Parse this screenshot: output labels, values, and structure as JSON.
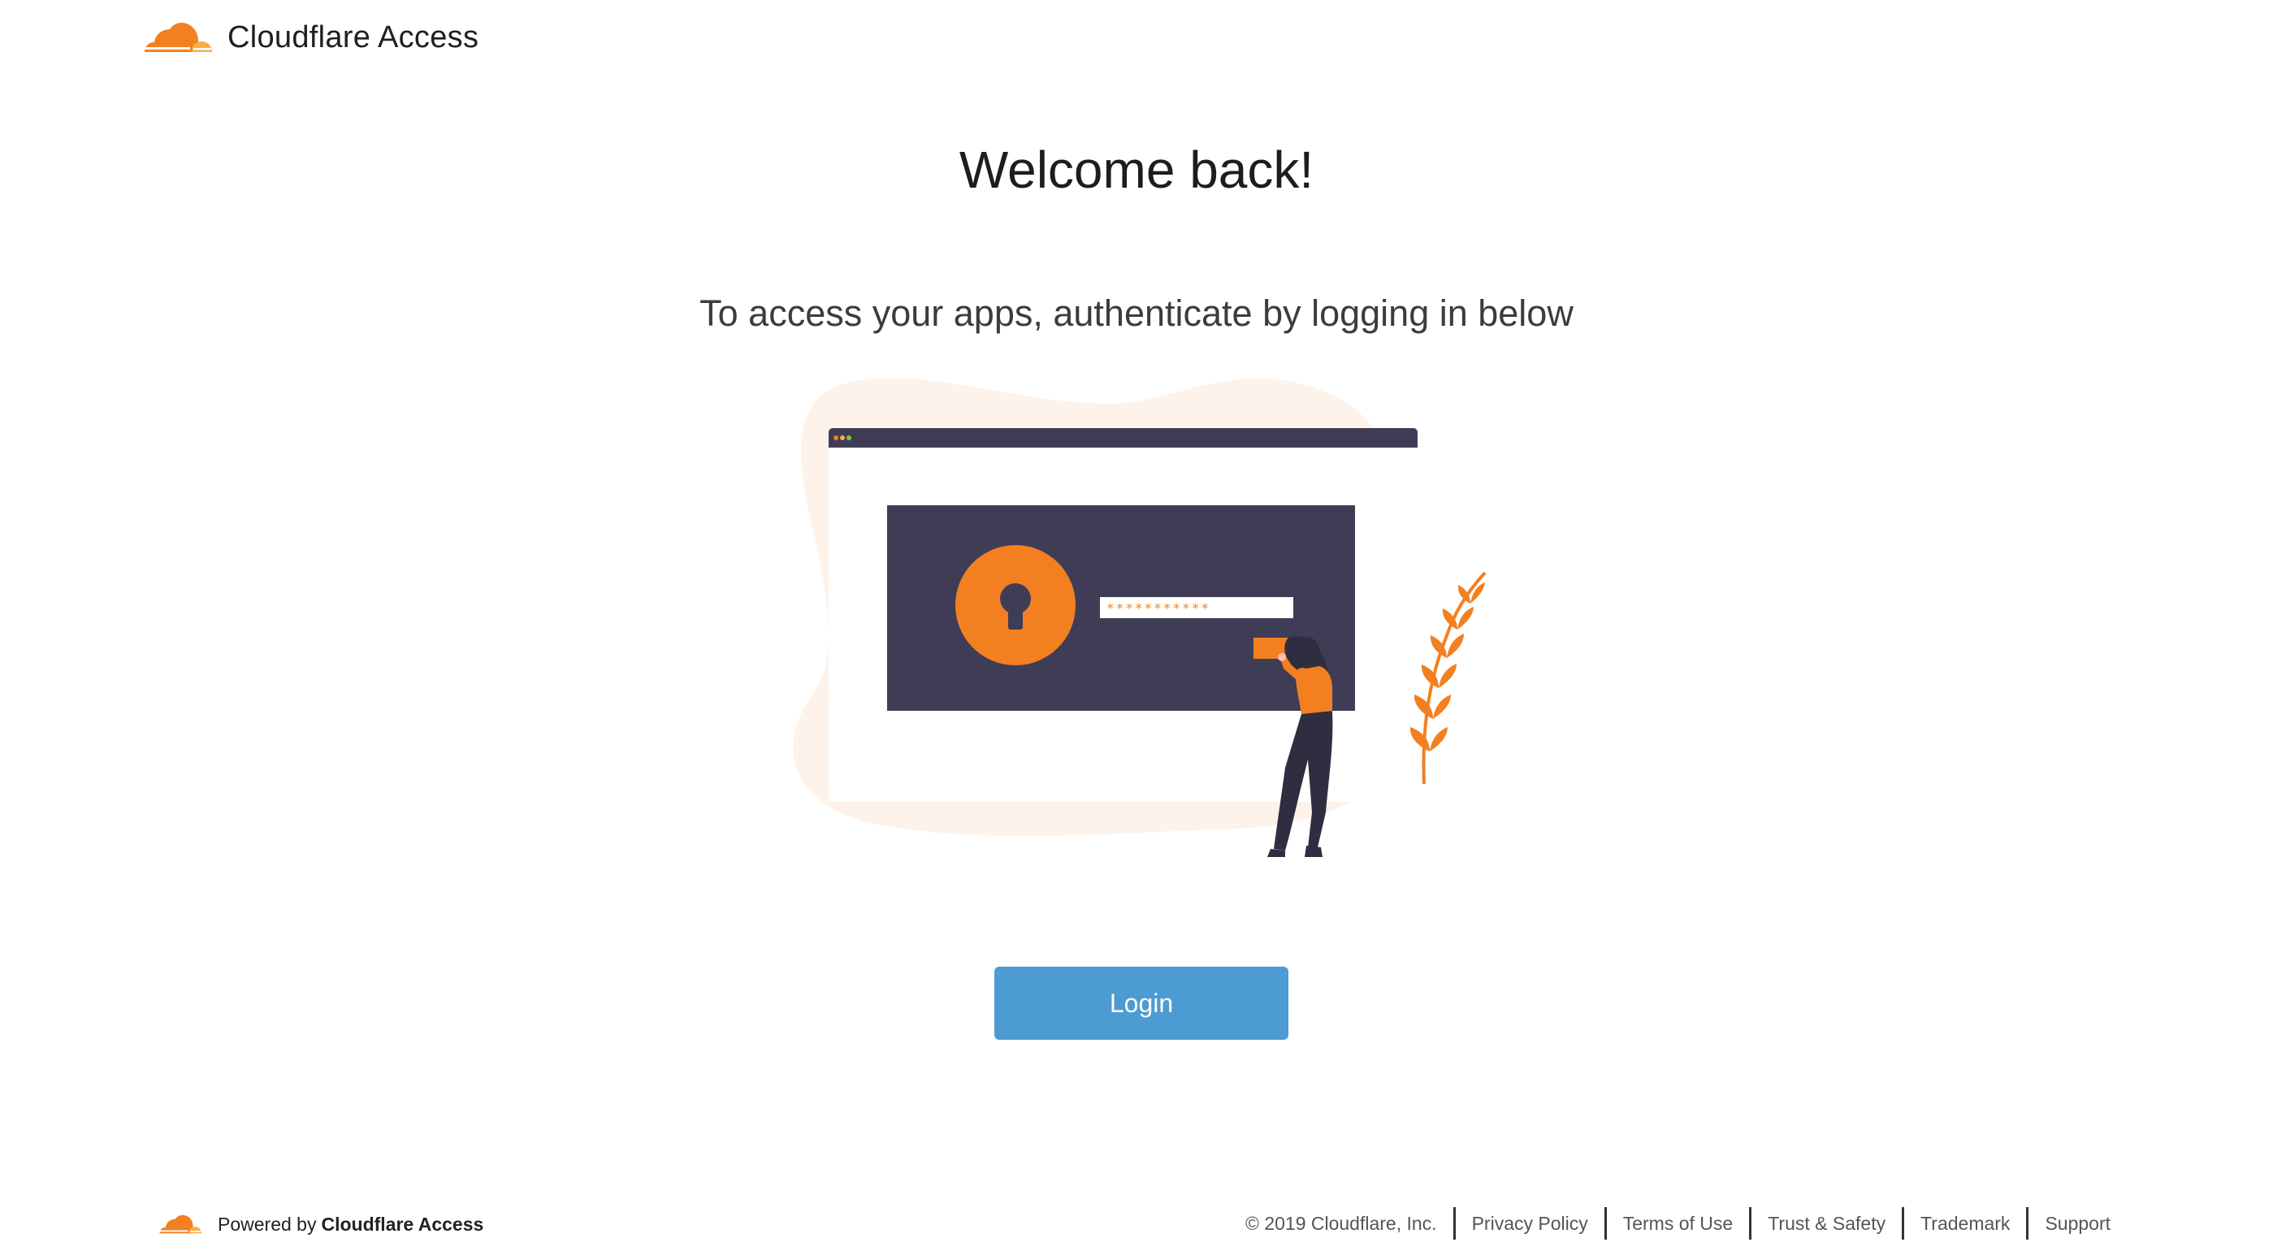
{
  "header": {
    "logo_icon": "cloudflare-cloud-icon",
    "brand_name": "Cloudflare Access"
  },
  "main": {
    "title": "Welcome back!",
    "subtitle": "To access your apps, authenticate by logging in below",
    "illustration": {
      "password_mask": "***********"
    },
    "login_button_label": "Login"
  },
  "footer": {
    "logo_icon": "cloudflare-cloud-icon",
    "powered_by": "Powered by",
    "powered_brand": "Cloudflare Access",
    "copyright": "© 2019 Cloudflare, Inc.",
    "links": [
      {
        "label": "Privacy Policy"
      },
      {
        "label": "Terms of Use"
      },
      {
        "label": "Trust & Safety"
      },
      {
        "label": "Trademark"
      },
      {
        "label": "Support"
      }
    ]
  },
  "colors": {
    "brand_orange": "#f38020",
    "brand_orange_light": "#faae40",
    "button_blue": "#4c9bd2",
    "screen_dark": "#3f3d56",
    "blob_peach": "#fdf3ea"
  }
}
